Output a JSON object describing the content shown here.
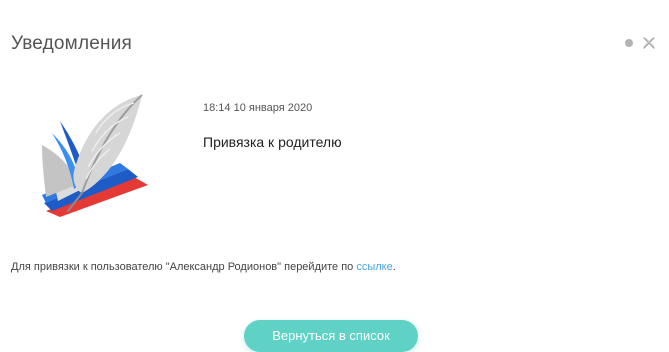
{
  "header": {
    "title": "Уведомления"
  },
  "notification": {
    "date": "18:14 10 января 2020",
    "subject": "Привязка к родителю",
    "body_prefix": "Для привязки к пользователю \"Александр Родионов\" перейдите по ",
    "link_label": "ссылке",
    "body_suffix": "."
  },
  "actions": {
    "back_label": "Вернуться в список"
  },
  "colors": {
    "accent": "#5fd1c5",
    "link": "#4aa3df",
    "status_dot": "#b3b3b3"
  },
  "icons": {
    "close": "close-icon",
    "status": "status-dot-icon",
    "logo": "quill-book-logo"
  }
}
